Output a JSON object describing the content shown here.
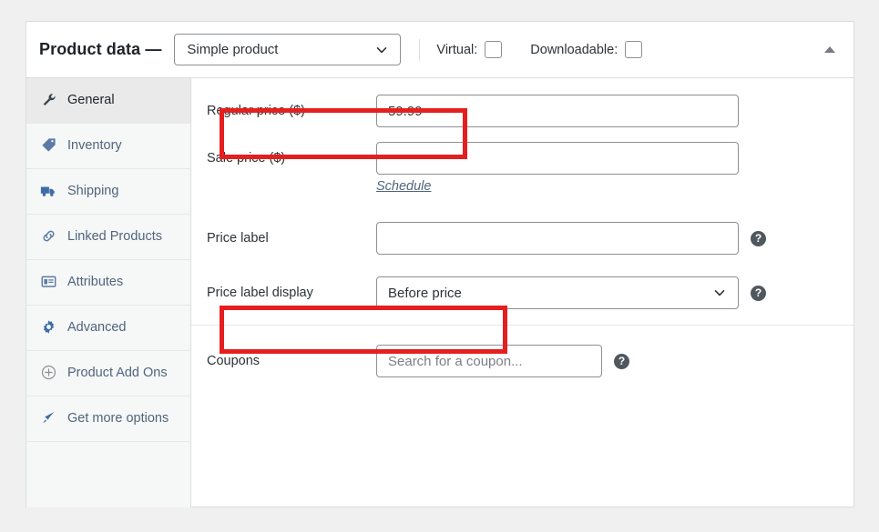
{
  "panel": {
    "title": "Product data —",
    "product_type": {
      "selected": "Simple product",
      "chevron_icon": "chevron-down-icon"
    },
    "virtual": {
      "label": "Virtual:",
      "checked": false
    },
    "downloadable": {
      "label": "Downloadable:",
      "checked": false
    },
    "collapse_icon": "triangle-up-icon"
  },
  "tabs": [
    {
      "label": "General",
      "icon": "wrench-icon",
      "active": true
    },
    {
      "label": "Inventory",
      "icon": "tag-icon",
      "active": false
    },
    {
      "label": "Shipping",
      "icon": "truck-icon",
      "active": false
    },
    {
      "label": "Linked Products",
      "icon": "link-icon",
      "active": false
    },
    {
      "label": "Attributes",
      "icon": "list-view-icon",
      "active": false
    },
    {
      "label": "Advanced",
      "icon": "gear-icon",
      "active": false
    },
    {
      "label": "Product Add Ons",
      "icon": "plus-circle-icon",
      "active": false
    },
    {
      "label": "Get more options",
      "icon": "megaphone-icon",
      "active": false
    }
  ],
  "fields": {
    "regular_price": {
      "label": "Regular price ($)",
      "value": "59.99",
      "placeholder": ""
    },
    "sale_price": {
      "label": "Sale price ($)",
      "value": "",
      "placeholder": ""
    },
    "schedule_link": {
      "label": "Schedule"
    },
    "price_label": {
      "label": "Price label",
      "value": "",
      "placeholder": "",
      "help_icon": "help-icon"
    },
    "price_label_display": {
      "label": "Price label display",
      "value": "Before price",
      "help_icon": "help-icon",
      "chevron_icon": "chevron-down-icon"
    },
    "coupons": {
      "label": "Coupons",
      "value": "",
      "placeholder": "Search for a coupon...",
      "help_icon": "help-icon"
    }
  },
  "annotations": [
    {
      "name": "regular-price-highlight",
      "color": "#e51f1f"
    },
    {
      "name": "price-label-display-highlight",
      "color": "#e51f1f"
    }
  ]
}
